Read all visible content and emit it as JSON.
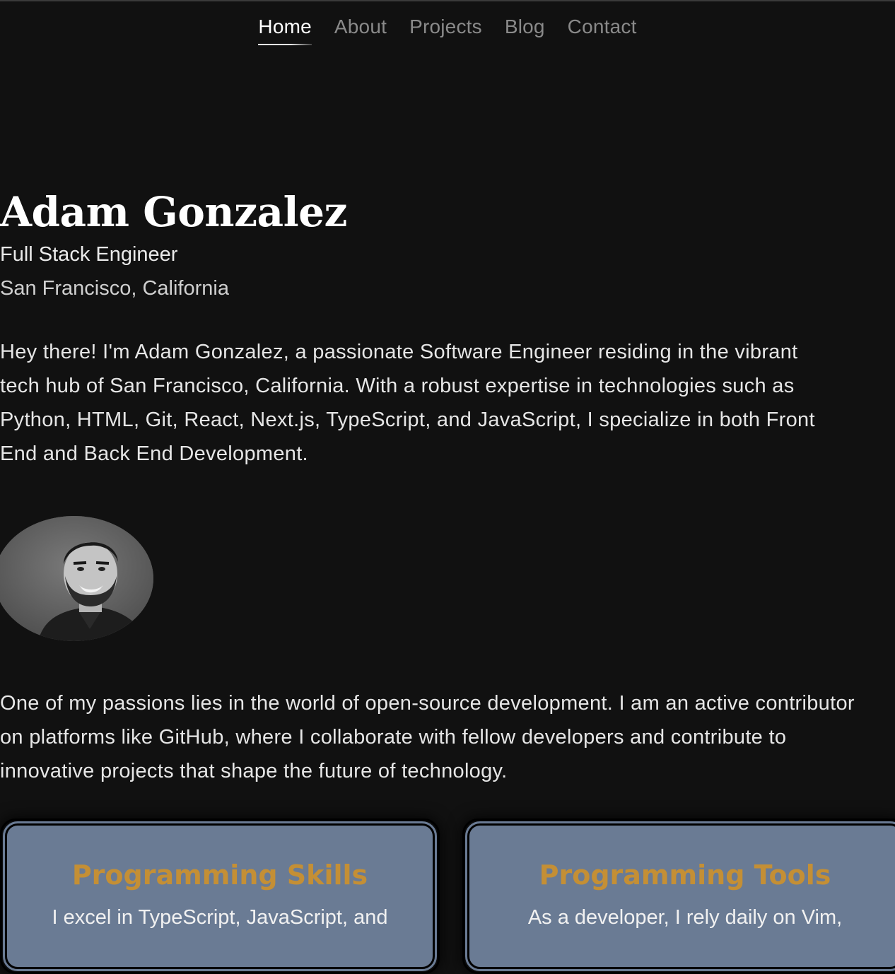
{
  "nav": {
    "items": [
      {
        "label": "Home",
        "active": true
      },
      {
        "label": "About"
      },
      {
        "label": "Projects"
      },
      {
        "label": "Blog"
      },
      {
        "label": "Contact"
      }
    ]
  },
  "hero": {
    "name": "Adam Gonzalez",
    "role": "Full Stack Engineer",
    "location": "San Francisco, California"
  },
  "intro": "Hey there! I'm Adam Gonzalez, a passionate Software Engineer residing in the vibrant tech hub of San Francisco, California. With a robust expertise in technologies such as Python, HTML, Git, React, Next.js, TypeScript, and JavaScript, I specialize in both Front End and Back End Development.",
  "avatar": {
    "icon": "profile-photo"
  },
  "passions": "One of my passions lies in the world of open-source development. I am an active contributor on platforms like GitHub, where I collaborate with fellow developers and contribute to innovative projects that shape the future of technology.",
  "cards": [
    {
      "title": "Programming Skills",
      "text": "I excel in TypeScript, JavaScript, and"
    },
    {
      "title": "Programming Tools",
      "text": "As a developer, I rely daily on Vim,"
    }
  ],
  "colors": {
    "background": "#111111",
    "card_bg": "#6a7b94",
    "card_title": "#c48f35"
  }
}
